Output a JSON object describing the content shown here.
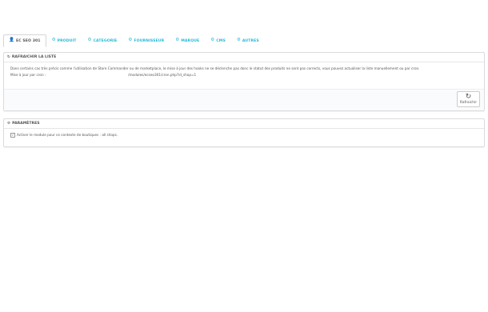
{
  "tabs": [
    {
      "label": "EC SEO 301",
      "icon": "user-icon"
    },
    {
      "label": "PRODUIT",
      "icon": "cogs-icon"
    },
    {
      "label": "CATEGORIE",
      "icon": "cogs-icon"
    },
    {
      "label": "FOURNISSEUR",
      "icon": "cogs-icon"
    },
    {
      "label": "MARQUE",
      "icon": "cogs-icon"
    },
    {
      "label": "CMS",
      "icon": "cogs-icon"
    },
    {
      "label": "AUTRES",
      "icon": "cogs-icon"
    }
  ],
  "refresh_panel": {
    "title": "RAFRAICHIR LA LISTE",
    "description": "Dans certains cas très précis comme l'utilisation de Store Commander ou de marketplace, le mise à jour des hooks ne se déclenche pas donc le statut des produits ne sont pas corrects, vous pouvez actualiser la liste manuellement ou par cron.",
    "cron_label": "Mise à jour par cron :",
    "cron_url": "/modules/ecseo301/cron.php?id_shop=1",
    "button_label": "Rafraichir"
  },
  "params_panel": {
    "title": "PARAMÈTRES",
    "checkbox_label": "Activer le module pour ce contexte de boutiques : all shops.",
    "checkbox_checked": true
  },
  "colors": {
    "accent": "#25b9d7",
    "text": "#555555",
    "border": "#dcdcdc"
  }
}
